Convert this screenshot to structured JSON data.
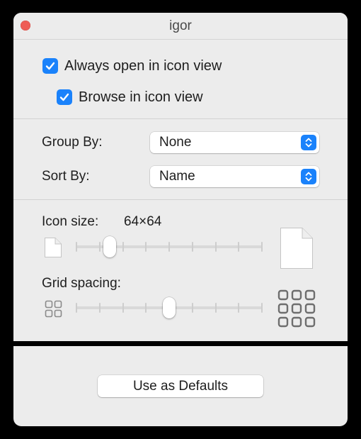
{
  "window": {
    "title": "igor"
  },
  "view_options": {
    "always_open_label": "Always open in icon view",
    "always_open_checked": true,
    "browse_label": "Browse in icon view",
    "browse_checked": true
  },
  "arrangement": {
    "group_by_label": "Group By:",
    "group_by_value": "None",
    "sort_by_label": "Sort By:",
    "sort_by_value": "Name"
  },
  "icon_size": {
    "label": "Icon size:",
    "value": "64×64",
    "slider_fraction": 0.18
  },
  "grid_spacing": {
    "label": "Grid spacing:",
    "slider_fraction": 0.5
  },
  "footer": {
    "defaults_label": "Use as Defaults"
  },
  "colors": {
    "accent": "#1a82fb",
    "close": "#ee5c55",
    "window_bg": "#ececec"
  },
  "icons": {
    "close": "close-button-dot",
    "check": "checkmark-icon",
    "popup": "up-down-chevron-icon",
    "small_doc": "small-document-icon",
    "large_doc": "large-document-icon",
    "small_grid": "small-grid-icon",
    "large_grid": "large-grid-icon"
  }
}
